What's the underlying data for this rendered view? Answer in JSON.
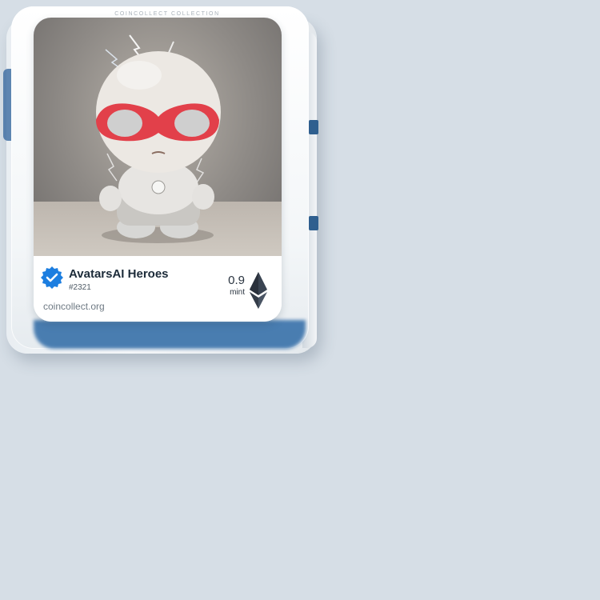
{
  "collection": {
    "label": "COINCOLLECT COLLECTION"
  },
  "nft": {
    "name": "AvatarsAI Heroes",
    "id": "#2321",
    "site": "coincollect.org",
    "price": "0.9",
    "price_label": "mint",
    "currency_icon": "ethereum-icon",
    "verified_icon": "verified-badge-icon"
  },
  "colors": {
    "background": "#d6dee6",
    "accent": "#2e6aa6",
    "badge": "#1c7ee0",
    "mask": "#e2404a"
  }
}
